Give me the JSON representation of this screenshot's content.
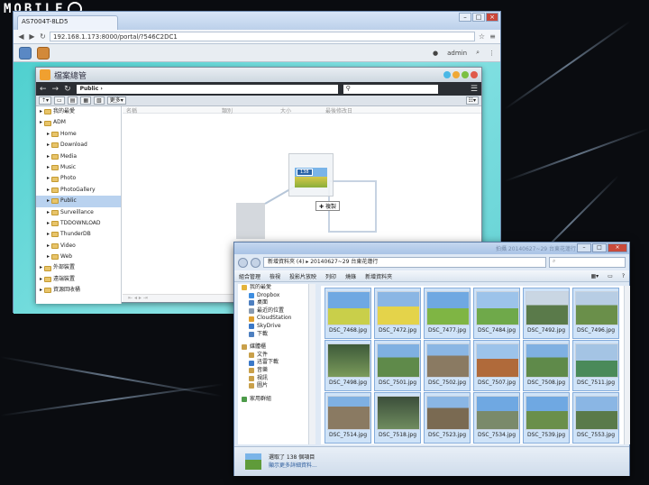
{
  "watermark": "MOBILE",
  "browser": {
    "tab_title": "AS7004T-8LD5",
    "url": "192.168.1.173:8000/portal/?546C2DC1",
    "window_buttons": [
      "–",
      "□",
      "×"
    ]
  },
  "adm_bar": {
    "user": "admin"
  },
  "file_manager": {
    "title": "檔案總管",
    "path": "Public",
    "toolbar": {
      "more_label": "更多"
    },
    "columns": [
      "名稱",
      "類別",
      "大小",
      "最後修改日"
    ],
    "tree": [
      {
        "label": "我的最愛",
        "level": 0
      },
      {
        "label": "ADM",
        "level": 0
      },
      {
        "label": "Home",
        "level": 1
      },
      {
        "label": "Download",
        "level": 1
      },
      {
        "label": "Media",
        "level": 1
      },
      {
        "label": "Music",
        "level": 1
      },
      {
        "label": "Photo",
        "level": 1
      },
      {
        "label": "PhotoGallery",
        "level": 1
      },
      {
        "label": "Public",
        "level": 1,
        "selected": true
      },
      {
        "label": "Surveillance",
        "level": 1
      },
      {
        "label": "TDDOWNLOAD",
        "level": 1
      },
      {
        "label": "ThunderDB",
        "level": 1
      },
      {
        "label": "Video",
        "level": 1
      },
      {
        "label": "Web",
        "level": 1
      },
      {
        "label": "外部裝置",
        "level": 0
      },
      {
        "label": "遠端裝置",
        "level": 0
      },
      {
        "label": "資源回收桶",
        "level": 0
      }
    ],
    "drag": {
      "count": "138",
      "action": "複製"
    }
  },
  "explorer": {
    "title_ghost": "拍攝 20140627~29 台東花蓮行",
    "breadcrumb": "新增資料夾 (4) ▸ 20140627~29 台東花蓮行",
    "commands": [
      "組合管理",
      "檢視",
      "投影片放映",
      "列印",
      "燒錄",
      "新增資料夾"
    ],
    "nav": [
      {
        "label": "我的最愛",
        "icon_color": "#e4b33a",
        "sub": false,
        "gap": false
      },
      {
        "label": "Dropbox",
        "icon_color": "#3f8ee0",
        "sub": true,
        "gap": false
      },
      {
        "label": "桌面",
        "icon_color": "#4d7fc0",
        "sub": true,
        "gap": false
      },
      {
        "label": "最近的位置",
        "icon_color": "#8a9bb0",
        "sub": true,
        "gap": false
      },
      {
        "label": "CloudStation",
        "icon_color": "#e0a030",
        "sub": true,
        "gap": false
      },
      {
        "label": "SkyDrive",
        "icon_color": "#3a78c8",
        "sub": true,
        "gap": false
      },
      {
        "label": "下載",
        "icon_color": "#4d7fc0",
        "sub": true,
        "gap": false
      },
      {
        "label": "媒體櫃",
        "icon_color": "#c9a04a",
        "sub": false,
        "gap": true
      },
      {
        "label": "文件",
        "icon_color": "#c9a04a",
        "sub": true,
        "gap": false
      },
      {
        "label": "迅雷下載",
        "icon_color": "#3a78c8",
        "sub": true,
        "gap": false
      },
      {
        "label": "音樂",
        "icon_color": "#c9a04a",
        "sub": true,
        "gap": false
      },
      {
        "label": "視訊",
        "icon_color": "#c9a04a",
        "sub": true,
        "gap": false
      },
      {
        "label": "圖片",
        "icon_color": "#c9a04a",
        "sub": true,
        "gap": false
      },
      {
        "label": "家用群組",
        "icon_color": "#4d9b4a",
        "sub": false,
        "gap": true
      }
    ],
    "files": [
      "DSC_7468.jpg",
      "DSC_7472.jpg",
      "DSC_7477.jpg",
      "DSC_7484.jpg",
      "DSC_7492.jpg",
      "DSC_7496.jpg",
      "DSC_7498.jpg",
      "DSC_7501.jpg",
      "DSC_7502.jpg",
      "DSC_7507.jpg",
      "DSC_7508.jpg",
      "DSC_7511.jpg",
      "DSC_7514.jpg",
      "DSC_7518.jpg",
      "DSC_7523.jpg",
      "DSC_7534.jpg",
      "DSC_7539.jpg",
      "DSC_7553.jpg"
    ],
    "status_line1": "選取了 138 個項目",
    "status_line2": "顯示更多詳細資料..."
  }
}
